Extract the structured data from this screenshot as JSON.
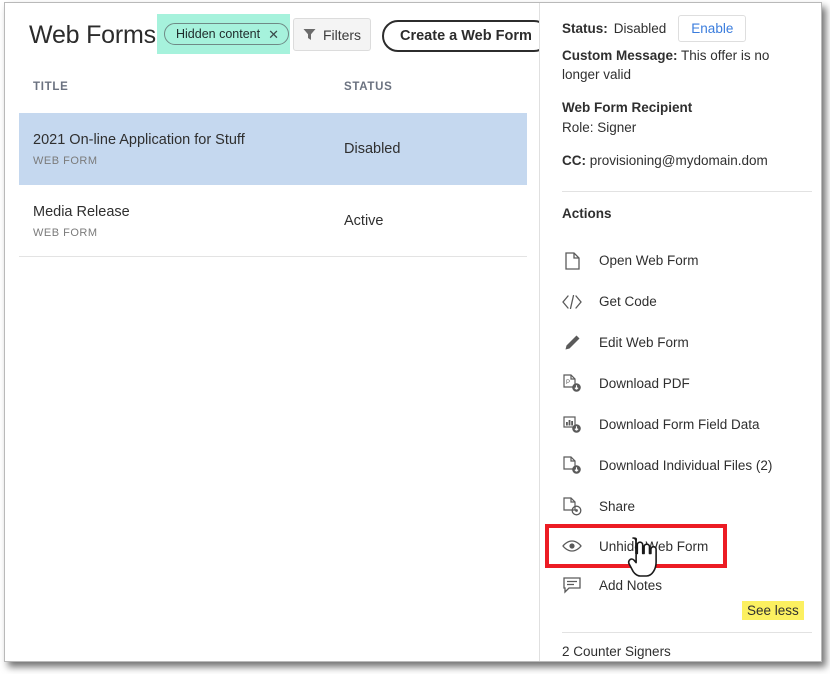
{
  "left": {
    "page_title": "Web Forms",
    "chip": {
      "label": "Hidden content",
      "close_icon": "close-icon",
      "highlight_color": "#a6f2dc"
    },
    "filters_button": {
      "label": "Filters",
      "icon": "funnel-icon"
    },
    "create_button": {
      "label": "Create a Web Form"
    },
    "columns": {
      "title": "TITLE",
      "status": "STATUS"
    },
    "rows": [
      {
        "title": "2021 On-line Application for Stuff",
        "type": "WEB FORM",
        "status": "Disabled",
        "selected": true
      },
      {
        "title": "Media Release",
        "type": "WEB FORM",
        "status": "Active",
        "selected": false
      }
    ],
    "selected_row_color": "#c5d8ef"
  },
  "right": {
    "status": {
      "label": "Status:",
      "value": "Disabled",
      "button": "Enable",
      "button_color": "#3b7ddd"
    },
    "custom_message": {
      "label": "Custom Message:",
      "value": "This offer is no longer valid"
    },
    "recipient": {
      "heading": "Web Form Recipient",
      "role": "Role: Signer"
    },
    "cc": {
      "label": "CC:",
      "value": "provisioning@mydomain.dom"
    },
    "actions_heading": "Actions",
    "actions": [
      {
        "label": "Open Web Form",
        "icon": "document-icon",
        "highlighted": false
      },
      {
        "label": "Get Code",
        "icon": "code-brackets-icon",
        "highlighted": false
      },
      {
        "label": "Edit Web Form",
        "icon": "pencil-icon",
        "highlighted": false
      },
      {
        "label": "Download PDF",
        "icon": "pdf-download-icon",
        "highlighted": false
      },
      {
        "label": "Download Form Field Data",
        "icon": "chart-download-icon",
        "highlighted": false
      },
      {
        "label": "Download Individual Files (2)",
        "icon": "file-download-icon",
        "highlighted": false
      },
      {
        "label": "Share",
        "icon": "file-share-icon",
        "highlighted": false
      },
      {
        "label": "Unhide Web Form",
        "icon": "eye-icon",
        "highlighted": true
      },
      {
        "label": "Add Notes",
        "icon": "comment-icon",
        "highlighted": false
      }
    ],
    "see_less": {
      "label": "See less",
      "highlight_color": "#fcf060"
    },
    "counter_signers": "2 Counter Signers",
    "highlight_box_color": "#ec1c24"
  }
}
